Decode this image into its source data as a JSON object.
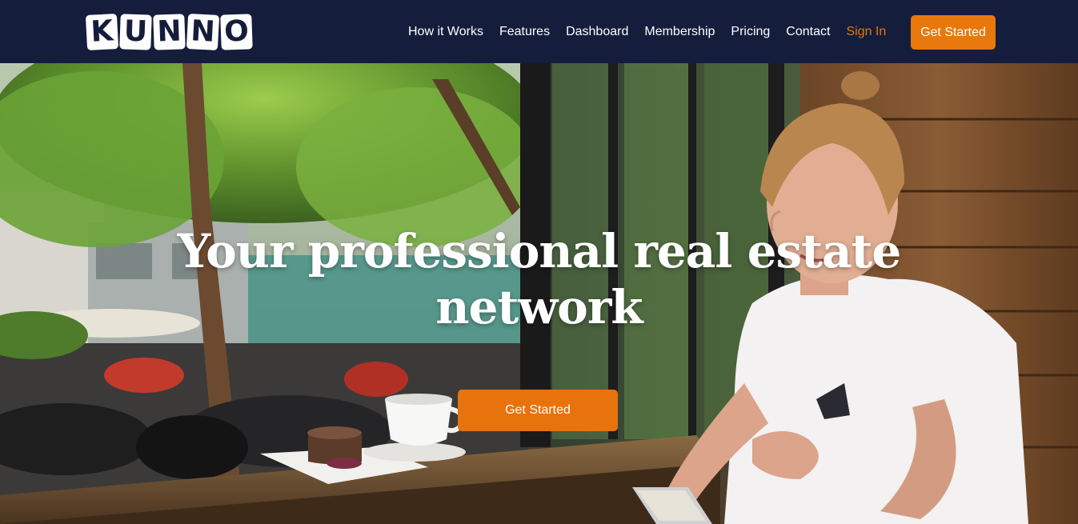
{
  "brand": {
    "logo_letters": [
      "K",
      "U",
      "N",
      "N",
      "O"
    ]
  },
  "nav": {
    "links": [
      {
        "label": "How it Works"
      },
      {
        "label": "Features"
      },
      {
        "label": "Dashboard"
      },
      {
        "label": "Membership"
      },
      {
        "label": "Pricing"
      },
      {
        "label": "Contact"
      }
    ],
    "signin_label": "Sign In",
    "cta_label": "Get Started"
  },
  "hero": {
    "title_line1": "Your professional real estate",
    "title_line2": "network",
    "cta_label": "Get Started"
  },
  "colors": {
    "nav_bg": "#141d3b",
    "accent": "#e8780b",
    "text_light": "#ffffff"
  }
}
